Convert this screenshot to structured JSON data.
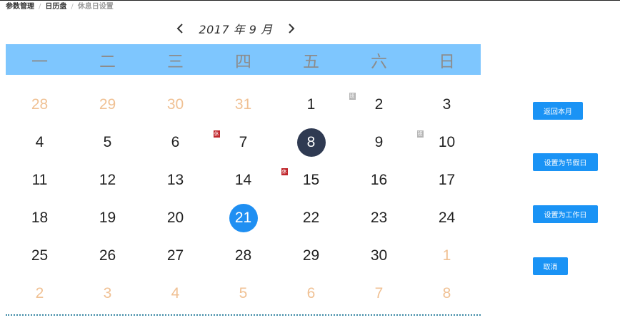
{
  "breadcrumb": [
    "参数管理",
    "日历盘",
    "休息日设置"
  ],
  "month_title": "2017 年 9 月",
  "prev_icon": "chevron-left-icon",
  "next_icon": "chevron-right-icon",
  "weekdays": [
    "一",
    "二",
    "三",
    "四",
    "五",
    "六",
    "日"
  ],
  "days": [
    {
      "n": "28",
      "other": true
    },
    {
      "n": "29",
      "other": true
    },
    {
      "n": "30",
      "other": true
    },
    {
      "n": "31",
      "other": true
    },
    {
      "n": "1"
    },
    {
      "n": "2",
      "badge": "班",
      "badge_type": "work"
    },
    {
      "n": "3"
    },
    {
      "n": "4"
    },
    {
      "n": "5"
    },
    {
      "n": "6"
    },
    {
      "n": "7",
      "badge": "休",
      "badge_type": "holiday"
    },
    {
      "n": "8",
      "state": "today"
    },
    {
      "n": "9"
    },
    {
      "n": "10",
      "badge": "班",
      "badge_type": "work"
    },
    {
      "n": "11"
    },
    {
      "n": "12"
    },
    {
      "n": "13"
    },
    {
      "n": "14"
    },
    {
      "n": "15",
      "badge": "休",
      "badge_type": "holiday"
    },
    {
      "n": "16"
    },
    {
      "n": "17"
    },
    {
      "n": "18"
    },
    {
      "n": "19"
    },
    {
      "n": "20"
    },
    {
      "n": "21",
      "state": "selected"
    },
    {
      "n": "22"
    },
    {
      "n": "23"
    },
    {
      "n": "24"
    },
    {
      "n": "25"
    },
    {
      "n": "26"
    },
    {
      "n": "27"
    },
    {
      "n": "28"
    },
    {
      "n": "29"
    },
    {
      "n": "30"
    },
    {
      "n": "1",
      "other": true
    },
    {
      "n": "2",
      "other": true
    },
    {
      "n": "3",
      "other": true
    },
    {
      "n": "4",
      "other": true
    },
    {
      "n": "5",
      "other": true
    },
    {
      "n": "6",
      "other": true
    },
    {
      "n": "7",
      "other": true
    },
    {
      "n": "8",
      "other": true
    }
  ],
  "buttons": {
    "back_to_month": "返回本月",
    "set_holiday": "设置为节假日",
    "set_workday": "设置为工作日",
    "cancel": "取消"
  },
  "colors": {
    "header_bg": "#7ec6fe",
    "today": "#2f3a52",
    "selected": "#1f8ff2",
    "other_month": "#f0c194",
    "holiday_badge": "#c0262c",
    "work_badge": "#b5b5b5",
    "button": "#1a93f5"
  }
}
